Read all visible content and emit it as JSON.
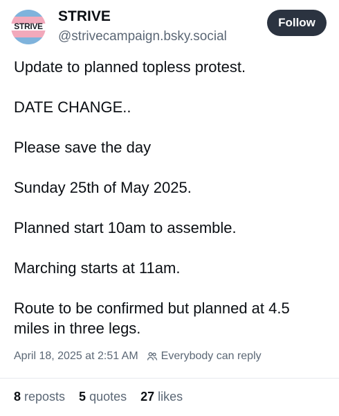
{
  "profile": {
    "avatar_text": "STRIVE",
    "avatar_colors": [
      "#7fb3dc",
      "#f2a9bb",
      "#ffffff"
    ],
    "name": "STRIVE",
    "handle": "@strivecampaign.bsky.social"
  },
  "header": {
    "follow_label": "Follow",
    "follow_bg": "#2b3340"
  },
  "post": {
    "paragraphs": [
      "Update to planned topless protest.",
      "DATE CHANGE..",
      "Please save the day",
      "Sunday 25th of May 2025.",
      "Planned start 10am to assemble.",
      "Marching starts at 11am.",
      "Route to be confirmed but planned at 4.5 miles in three legs."
    ]
  },
  "meta": {
    "timestamp": "April 18, 2025 at 2:51 AM",
    "reply_icon": "people-icon",
    "reply_setting": "Everybody can reply"
  },
  "stats": {
    "reposts_count": "8",
    "reposts_label": "reposts",
    "quotes_count": "5",
    "quotes_label": "quotes",
    "likes_count": "27",
    "likes_label": "likes"
  }
}
